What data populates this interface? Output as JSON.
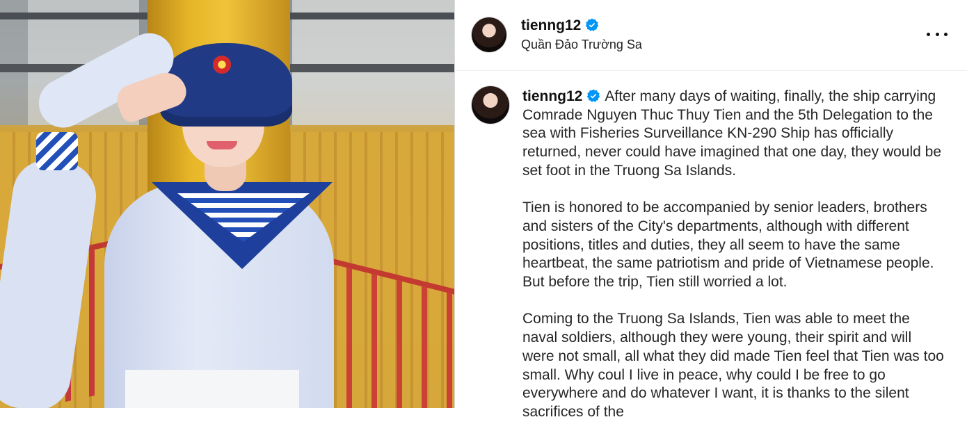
{
  "post": {
    "username": "tienng12",
    "location": "Quần Đảo Trường Sa",
    "verified_icon": "verified-badge-icon",
    "more_icon": "more-options-icon",
    "verified_color": "#0095f6"
  },
  "caption": {
    "username": "tienng12",
    "paragraphs": [
      "After many days of waiting, finally, the ship carrying Comrade Nguyen Thuc Thuy Tien and the 5th Delegation to the sea with Fisheries Surveillance KN-290 Ship has officially returned, never could have imagined that one day, they would be set foot in the Truong Sa Islands.",
      "Tien is honored to be accompanied by senior leaders, brothers and sisters of the City's departments, although with different positions, titles and duties, they all seem to have the same heartbeat, the same patriotism and pride of Vietnamese people. But before the trip, Tien still worried a lot.",
      "Coming to the Truong Sa Islands, Tien was able to meet the naval soldiers, although they were young, their spirit and will were not small, all what they did made Tien feel that Tien was too small. Why coul I live in peace, why could I be free to go everywhere and do whatever I want, it is thanks to the silent sacrifices of the"
    ]
  }
}
